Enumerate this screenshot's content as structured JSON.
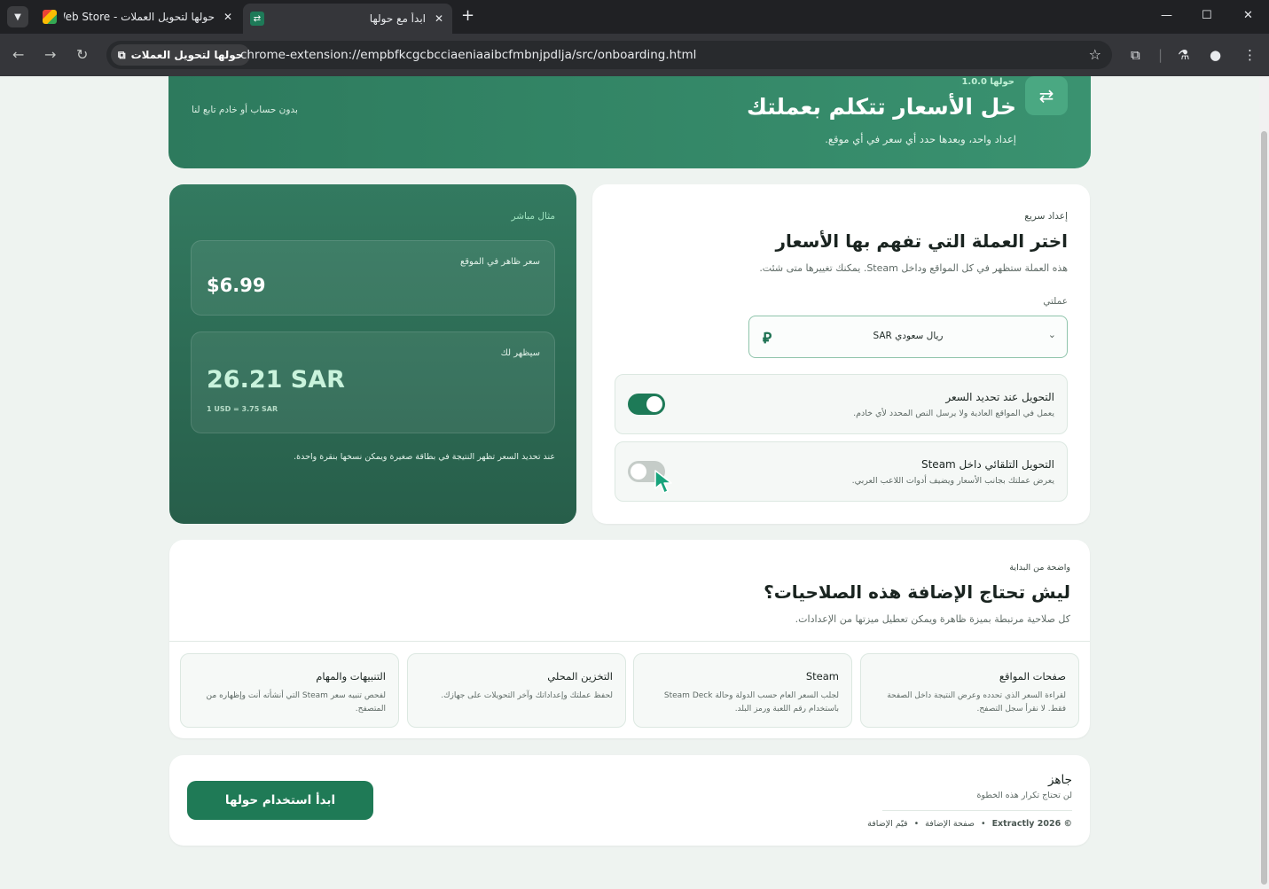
{
  "browser": {
    "tabs": [
      {
        "title": "حولها لتحويل العملات - Chrome Web Store",
        "active": false
      },
      {
        "title": "ابدأ مع حولها",
        "active": true
      }
    ],
    "site_chip": "حولها لتحويل العملات",
    "url": "chrome-extension://empbfkcgcbcciaeniaaibcfmbnjpdlja/src/onboarding.html"
  },
  "hero": {
    "version": "حولها 1.0.0",
    "title": "خل الأسعار تتكلم بعملتك",
    "subtitle": "إعداد واحد، وبعدها حدد أي سعر في أي موقع.",
    "note": "بدون حساب أو خادم تابع لنا"
  },
  "setup": {
    "eyebrow": "إعداد سريع",
    "title": "اختر العملة التي تفهم بها الأسعار",
    "desc": "هذه العملة ستظهر في كل المواقع وداخل Steam. يمكنك تغييرها متى شئت.",
    "currency_label": "عملتي",
    "currency_value": "ريال سعودي SAR",
    "currency_symbol": "⃁",
    "toggles": [
      {
        "title": "التحويل عند تحديد السعر",
        "desc": "يعمل في المواقع العادية ولا يرسل النص المحدد لأي خادم.",
        "on": true
      },
      {
        "title": "التحويل التلقائي داخل Steam",
        "desc": "يعرض عملتك بجانب الأسعار ويضيف أدوات اللاعب العربي.",
        "on": false
      }
    ]
  },
  "live": {
    "label": "مثال مباشر",
    "site_caption": "سعر ظاهر في الموقع",
    "site_price": "$6.99",
    "you_caption": "سيظهر لك",
    "you_price": "26.21 SAR",
    "rate": "1 USD = 3.75 SAR",
    "footer": "عند تحديد السعر تظهر النتيجة في بطاقة صغيرة ويمكن نسخها بنقرة واحدة."
  },
  "perms": {
    "eyebrow": "واضحة من البداية",
    "title": "ليش تحتاج الإضافة هذه الصلاحيات؟",
    "desc": "كل صلاحية مرتبطة بميزة ظاهرة ويمكن تعطيل ميزتها من الإعدادات.",
    "items": [
      {
        "title": "صفحات المواقع",
        "desc": "لقراءة السعر الذي تحدده وعرض النتيجة داخل الصفحة فقط. لا نقرأ سجل التصفح."
      },
      {
        "title": "Steam",
        "desc": "لجلب السعر العام حسب الدولة وحالة Steam Deck باستخدام رقم اللعبة ورمز البلد."
      },
      {
        "title": "التخزين المحلي",
        "desc": "لحفظ عملتك وإعداداتك وآخر التحويلات على جهازك."
      },
      {
        "title": "التنبيهات والمهام",
        "desc": "لفحص تنبيه سعر Steam التي أنشأته أنت وإظهاره من المتصفح."
      }
    ]
  },
  "ready": {
    "title": "جاهز",
    "subtitle": "لن تحتاج تكرار هذه الخطوة",
    "start_button": "ابدأ استخدام حولها",
    "footer_links": [
      "© Extractly 2026",
      "•",
      "صفحة الإضافة",
      "•",
      "قيّم الإضافة"
    ]
  },
  "colors": {
    "brand": "#1f7a56",
    "hero": "#338466",
    "accent": "#9ee3bf",
    "page_bg": "#eef3f0"
  }
}
